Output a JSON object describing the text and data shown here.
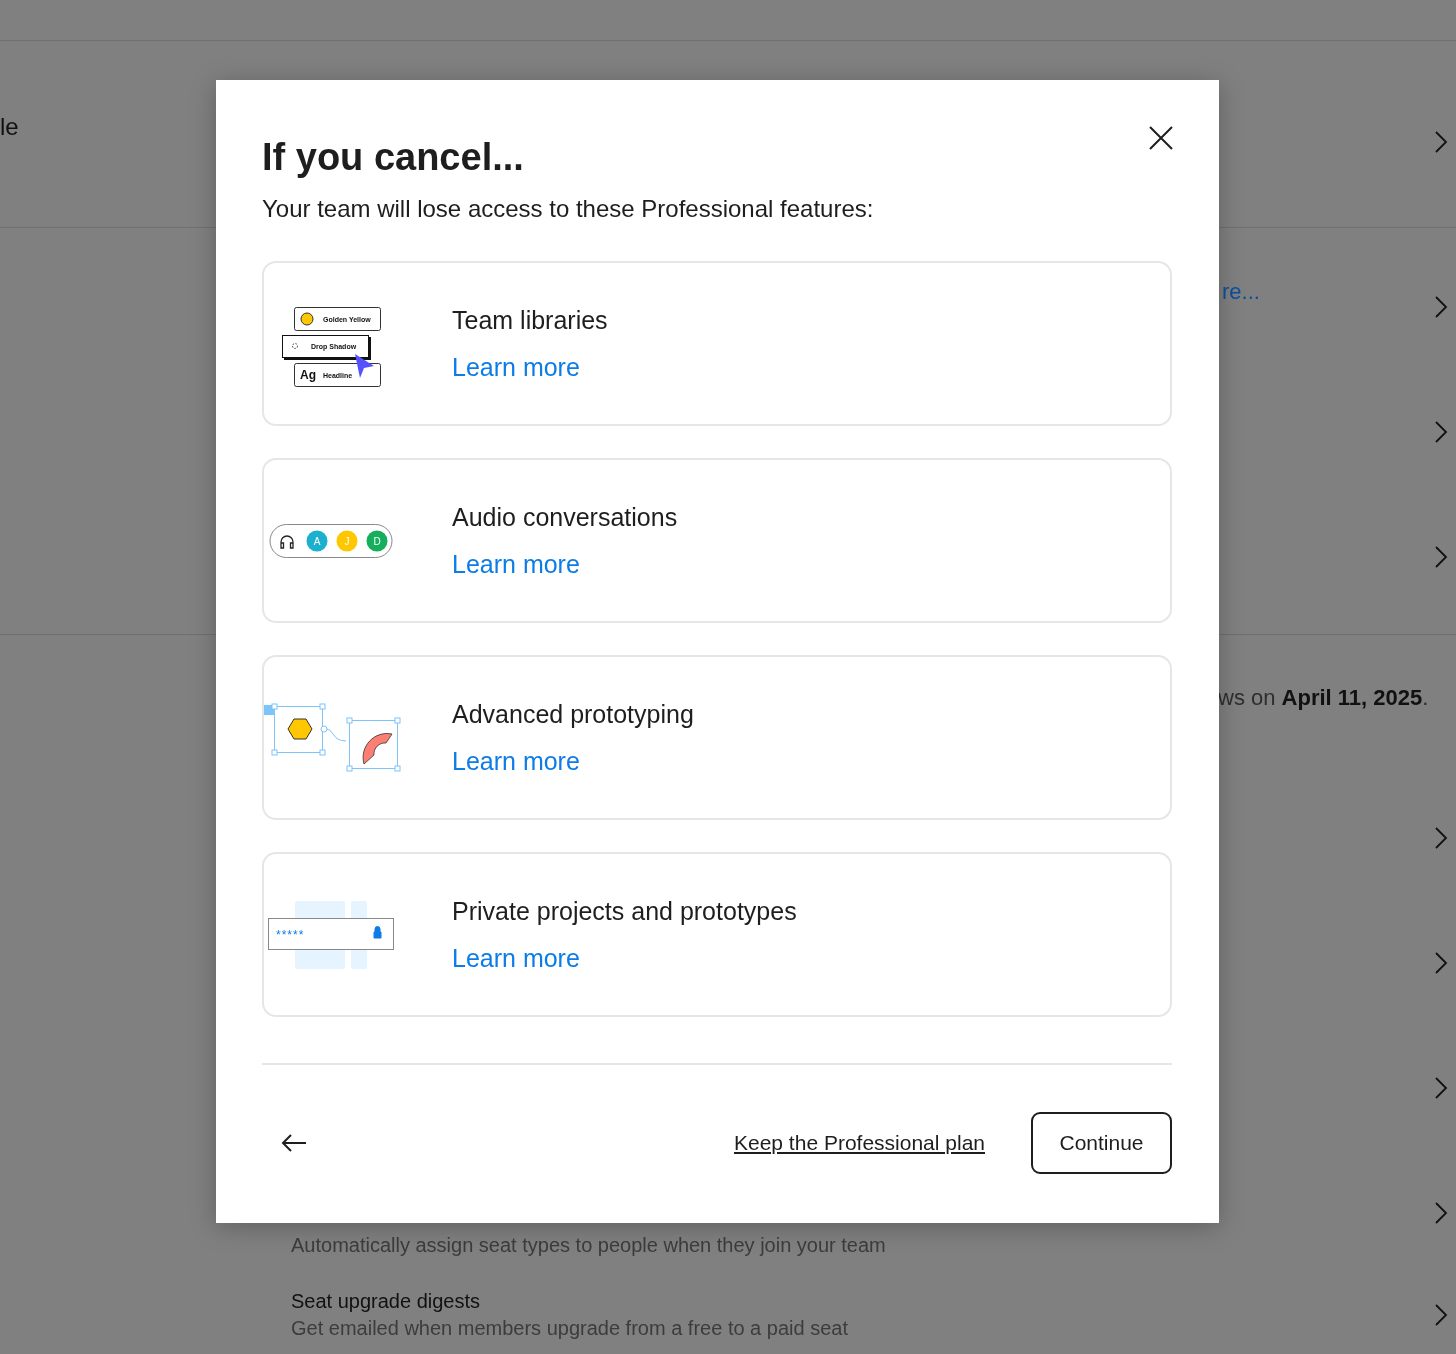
{
  "background": {
    "sections": [
      {
        "rows": [
          {
            "title": "le"
          }
        ]
      },
      {
        "rows": [
          {
            "link": "re..."
          },
          {},
          {}
        ]
      },
      {
        "notice": "ws on **April 11, 2025**.",
        "rows": [
          {},
          {},
          {},
          {
            "description": "Automatically assign seat types to people when they join your team"
          },
          {
            "title": "Seat upgrade digests",
            "description": "Get emailed when members upgrade from a free to a paid seat"
          }
        ]
      }
    ]
  },
  "dialog": {
    "title": "If you cancel...",
    "subtitle": "Your team will lose access to these Professional features:",
    "features": [
      {
        "kind": "libraries",
        "title": "Team libraries",
        "link": "Learn more",
        "labels": [
          "Golden Yellow",
          "Drop Shadow",
          "Ag",
          "Headline"
        ]
      },
      {
        "kind": "audio",
        "title": "Audio conversations",
        "link": "Learn more",
        "avatars": [
          {
            "initial": "A",
            "color": "#1bb0ce"
          },
          {
            "initial": "J",
            "color": "#ffc700"
          },
          {
            "initial": "D",
            "color": "#14ae5c"
          }
        ]
      },
      {
        "kind": "prototype",
        "title": "Advanced prototyping",
        "link": "Learn more"
      },
      {
        "kind": "private",
        "title": "Private projects and prototypes",
        "link": "Learn more",
        "password": "*****"
      }
    ],
    "footer": {
      "keep_link": "Keep the Professional plan",
      "continue": "Continue"
    }
  }
}
